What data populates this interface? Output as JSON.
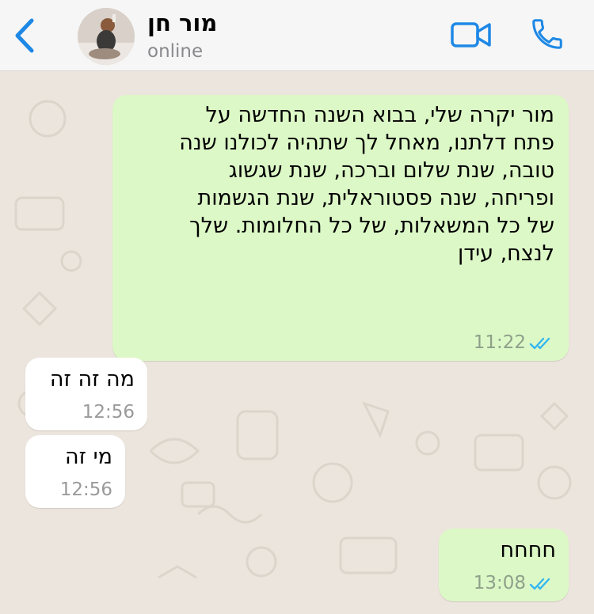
{
  "header": {
    "back_icon": "chevron-left-icon",
    "contact_name": "מור חן",
    "status": "online",
    "video_icon": "video-camera-icon",
    "call_icon": "phone-icon",
    "accent_color": "#1e88e5"
  },
  "messages": [
    {
      "direction": "outgoing",
      "lines": [
        "מור יקרה שלי, בבוא השנה החדשה על",
        "פתח דלתנו, מאחל לך שתהיה לכולנו שנה",
        "טובה, שנת שלום וברכה, שנת שגשוג",
        "ופריחה, שנה פסטוראלית, שנת הגשמות",
        "של כל המשאלות, של כל החלומות. שלך",
        "לנצח, עידן"
      ],
      "time": "11:22",
      "status": "read"
    },
    {
      "direction": "incoming",
      "lines": [
        "מה זה זה"
      ],
      "time": "12:56"
    },
    {
      "direction": "incoming",
      "lines": [
        "מי זה"
      ],
      "time": "12:56"
    },
    {
      "direction": "outgoing",
      "lines": [
        "חחחח"
      ],
      "time": "13:08",
      "status": "read"
    }
  ],
  "colors": {
    "outgoing_bubble": "#dcf8c6",
    "incoming_bubble": "#ffffff",
    "chat_background": "#ece5dd",
    "read_ticks": "#34b7f1"
  }
}
